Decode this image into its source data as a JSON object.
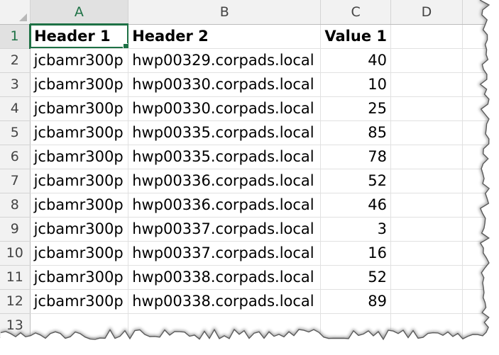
{
  "columns": [
    "A",
    "B",
    "C",
    "D"
  ],
  "header_row": {
    "row": "1",
    "a": "Header 1",
    "b": "Header 2",
    "c": "Value 1",
    "d": ""
  },
  "rows": [
    {
      "row": "2",
      "a": "jcbamr300p",
      "b": "hwp00329.corpads.local",
      "c": "40"
    },
    {
      "row": "3",
      "a": "jcbamr300p",
      "b": "hwp00330.corpads.local",
      "c": "10"
    },
    {
      "row": "4",
      "a": "jcbamr300p",
      "b": "hwp00330.corpads.local",
      "c": "25"
    },
    {
      "row": "5",
      "a": "jcbamr300p",
      "b": "hwp00335.corpads.local",
      "c": "85"
    },
    {
      "row": "6",
      "a": "jcbamr300p",
      "b": "hwp00335.corpads.local",
      "c": "78"
    },
    {
      "row": "7",
      "a": "jcbamr300p",
      "b": "hwp00336.corpads.local",
      "c": "52"
    },
    {
      "row": "8",
      "a": "jcbamr300p",
      "b": "hwp00336.corpads.local",
      "c": "46"
    },
    {
      "row": "9",
      "a": "jcbamr300p",
      "b": "hwp00337.corpads.local",
      "c": "3"
    },
    {
      "row": "10",
      "a": "jcbamr300p",
      "b": "hwp00337.corpads.local",
      "c": "16"
    },
    {
      "row": "11",
      "a": "jcbamr300p",
      "b": "hwp00338.corpads.local",
      "c": "52"
    },
    {
      "row": "12",
      "a": "jcbamr300p",
      "b": "hwp00338.corpads.local",
      "c": "89"
    },
    {
      "row": "13",
      "a": "",
      "b": "",
      "c": ""
    }
  ],
  "selection": {
    "active_cell": "A1"
  },
  "colors": {
    "accent": "#1e7145",
    "header_bg": "#f2f2f2",
    "selected_header_bg": "#e1e1e1",
    "gridline": "#e1e1e1"
  }
}
